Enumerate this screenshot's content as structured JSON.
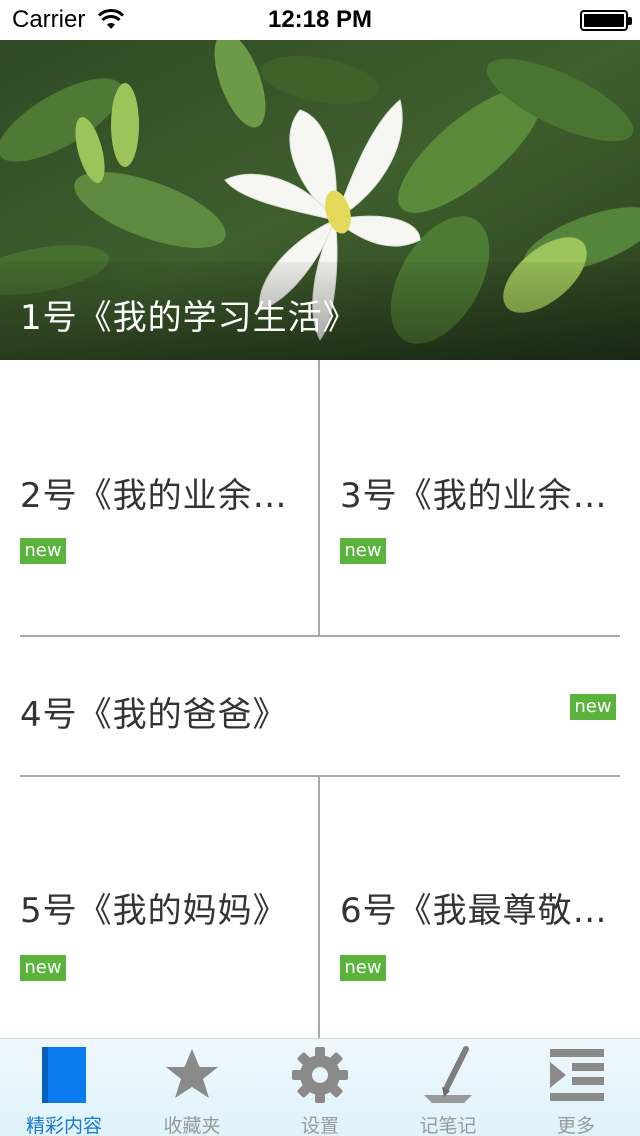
{
  "status_bar": {
    "carrier": "Carrier",
    "time": "12:18 PM"
  },
  "hero": {
    "title": "1号《我的学习生活》"
  },
  "items": [
    {
      "title": "2号《我的业余…",
      "badge": "new"
    },
    {
      "title": "3号《我的业余…",
      "badge": "new"
    },
    {
      "title": "4号《我的爸爸》",
      "badge": "new"
    },
    {
      "title": "5号《我的妈妈》",
      "badge": "new"
    },
    {
      "title": "6号《我最尊敬…",
      "badge": "new"
    }
  ],
  "tab_bar": {
    "tabs": [
      {
        "label": "精彩内容",
        "icon": "book-icon",
        "active": true
      },
      {
        "label": "收藏夹",
        "icon": "star-icon",
        "active": false
      },
      {
        "label": "设置",
        "icon": "gear-icon",
        "active": false
      },
      {
        "label": "记笔记",
        "icon": "pen-icon",
        "active": false
      },
      {
        "label": "更多",
        "icon": "list-icon",
        "active": false
      }
    ]
  },
  "colors": {
    "badge": "#5ab33a",
    "tab_active": "#1577d6",
    "tab_inactive": "#9a9a9a",
    "divider": "#a9a9a9"
  }
}
